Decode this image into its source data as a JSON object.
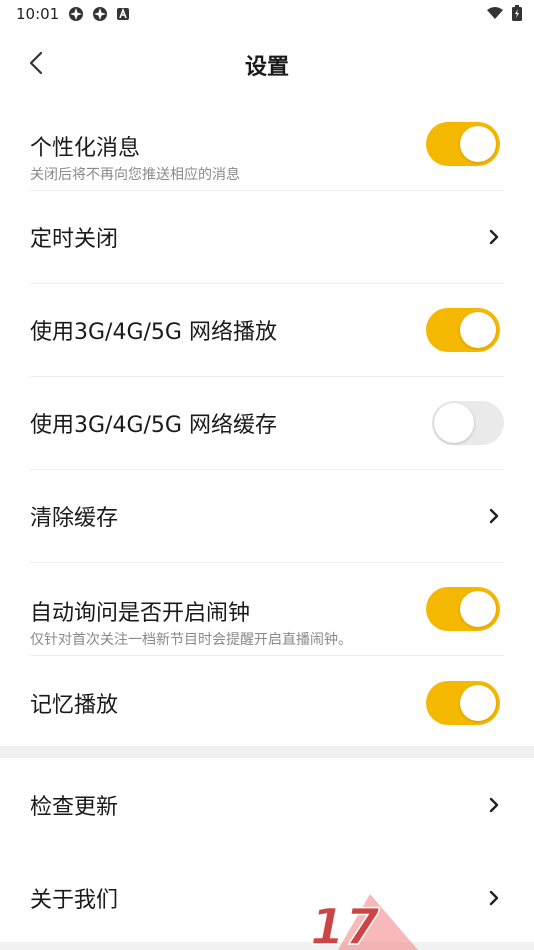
{
  "status_bar": {
    "time": "10:01"
  },
  "header": {
    "title": "设置"
  },
  "settings": [
    {
      "label": "个性化消息",
      "sublabel": "关闭后将不再向您推送相应的消息",
      "control": "toggle",
      "on": true
    },
    {
      "label": "定时关闭",
      "control": "chevron"
    },
    {
      "label": "使用3G/4G/5G 网络播放",
      "control": "toggle",
      "on": true
    },
    {
      "label": "使用3G/4G/5G 网络缓存",
      "control": "toggle",
      "on": false
    },
    {
      "label": "清除缓存",
      "control": "chevron"
    },
    {
      "label": "自动询问是否开启闹钟",
      "sublabel": "仅针对首次关注一档新节目时会提醒开启直播闹钟。",
      "control": "toggle",
      "on": true
    },
    {
      "label": "记忆播放",
      "control": "toggle",
      "on": true
    }
  ],
  "settings_2": [
    {
      "label": "检查更新",
      "control": "chevron"
    },
    {
      "label": "关于我们",
      "control": "chevron"
    }
  ],
  "colors": {
    "accent": "#f5b800",
    "toggle_off": "#eaeaea",
    "divider": "#eeeeee",
    "group_gap": "#f1f1f1"
  }
}
